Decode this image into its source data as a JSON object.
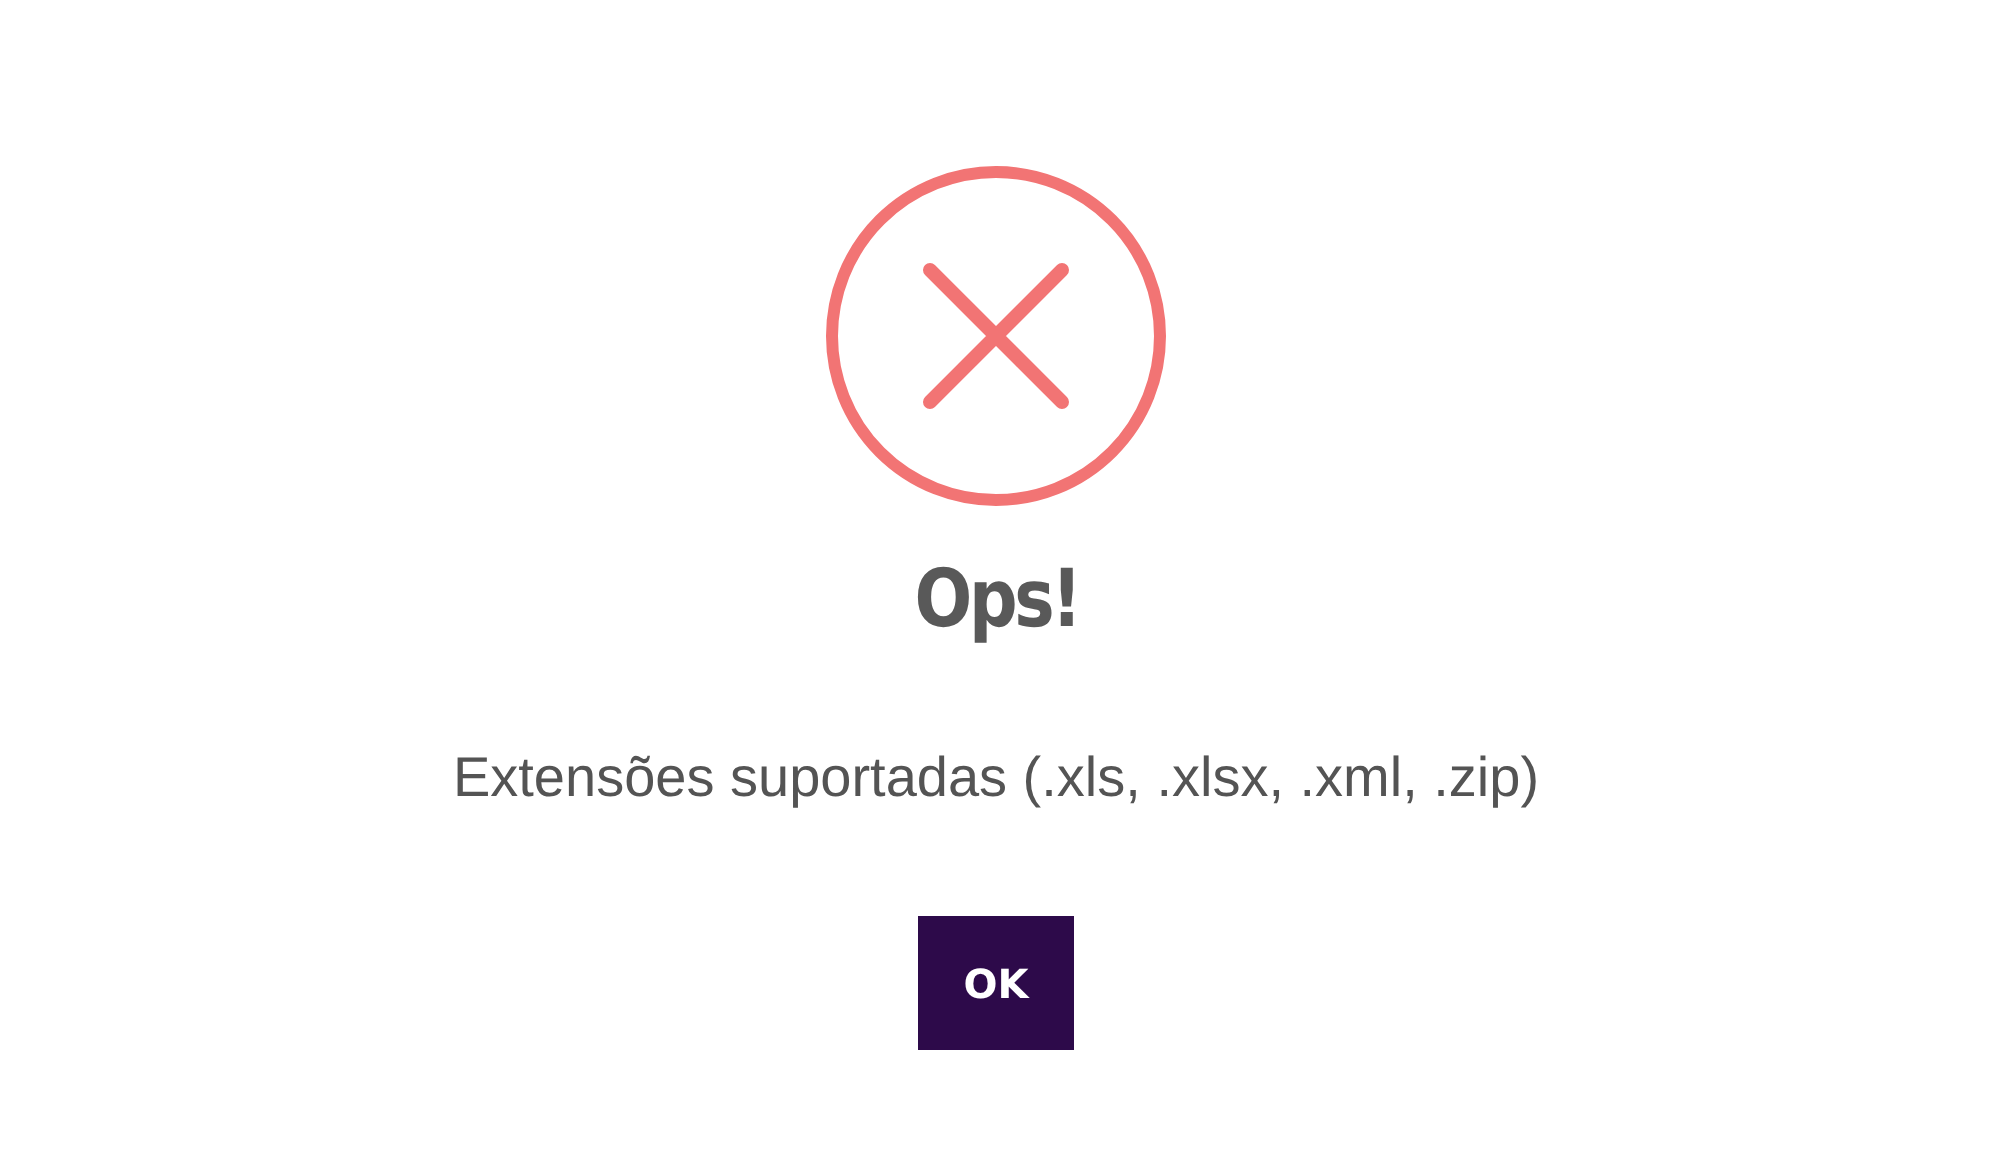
{
  "dialog": {
    "kind": "error",
    "title": "Ops!",
    "message": "Extensões suportadas (.xls, .xlsx, .xml, .zip)",
    "buttons": [
      {
        "label": "OK"
      }
    ]
  }
}
